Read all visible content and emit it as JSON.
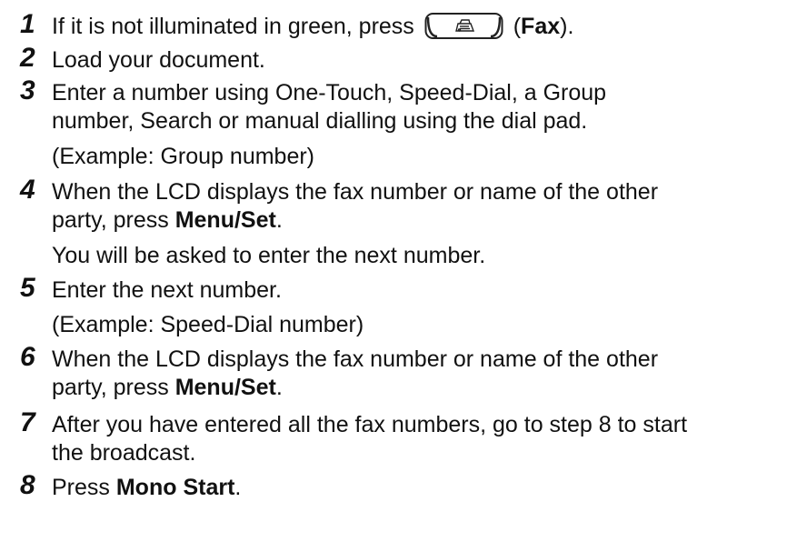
{
  "steps": [
    {
      "n": "1",
      "pre": "If it is not illuminated in green, press",
      "icon": "fax-machine-icon",
      "open": "(",
      "bold": "Fax",
      "close": ")."
    },
    {
      "n": "2",
      "text": "Load your document."
    },
    {
      "n": "3",
      "line1": "Enter a number using One-Touch, Speed-Dial, a Group",
      "line2": "number, Search or manual dialling using the dial pad.",
      "note": "(Example: Group number)"
    },
    {
      "n": "4",
      "line1": "When the LCD displays the fax number or name of the other",
      "line2_pre": "party, press",
      "bold": "Menu/Set",
      "line2_post": ".",
      "note": "You will be asked to enter the next number."
    },
    {
      "n": "5",
      "text": "Enter the next number.",
      "note": "(Example: Speed-Dial number)"
    },
    {
      "n": "6",
      "line1": "When the LCD displays the fax number or name of the other",
      "line2_pre": "party, press",
      "bold": "Menu/Set",
      "line2_post": "."
    },
    {
      "n": "7",
      "line1": "After you have entered all the fax numbers, go to step 8 to start",
      "line2": "the broadcast."
    },
    {
      "n": "8",
      "pre": "Press",
      "bold": "Mono Start",
      "post": "."
    }
  ]
}
